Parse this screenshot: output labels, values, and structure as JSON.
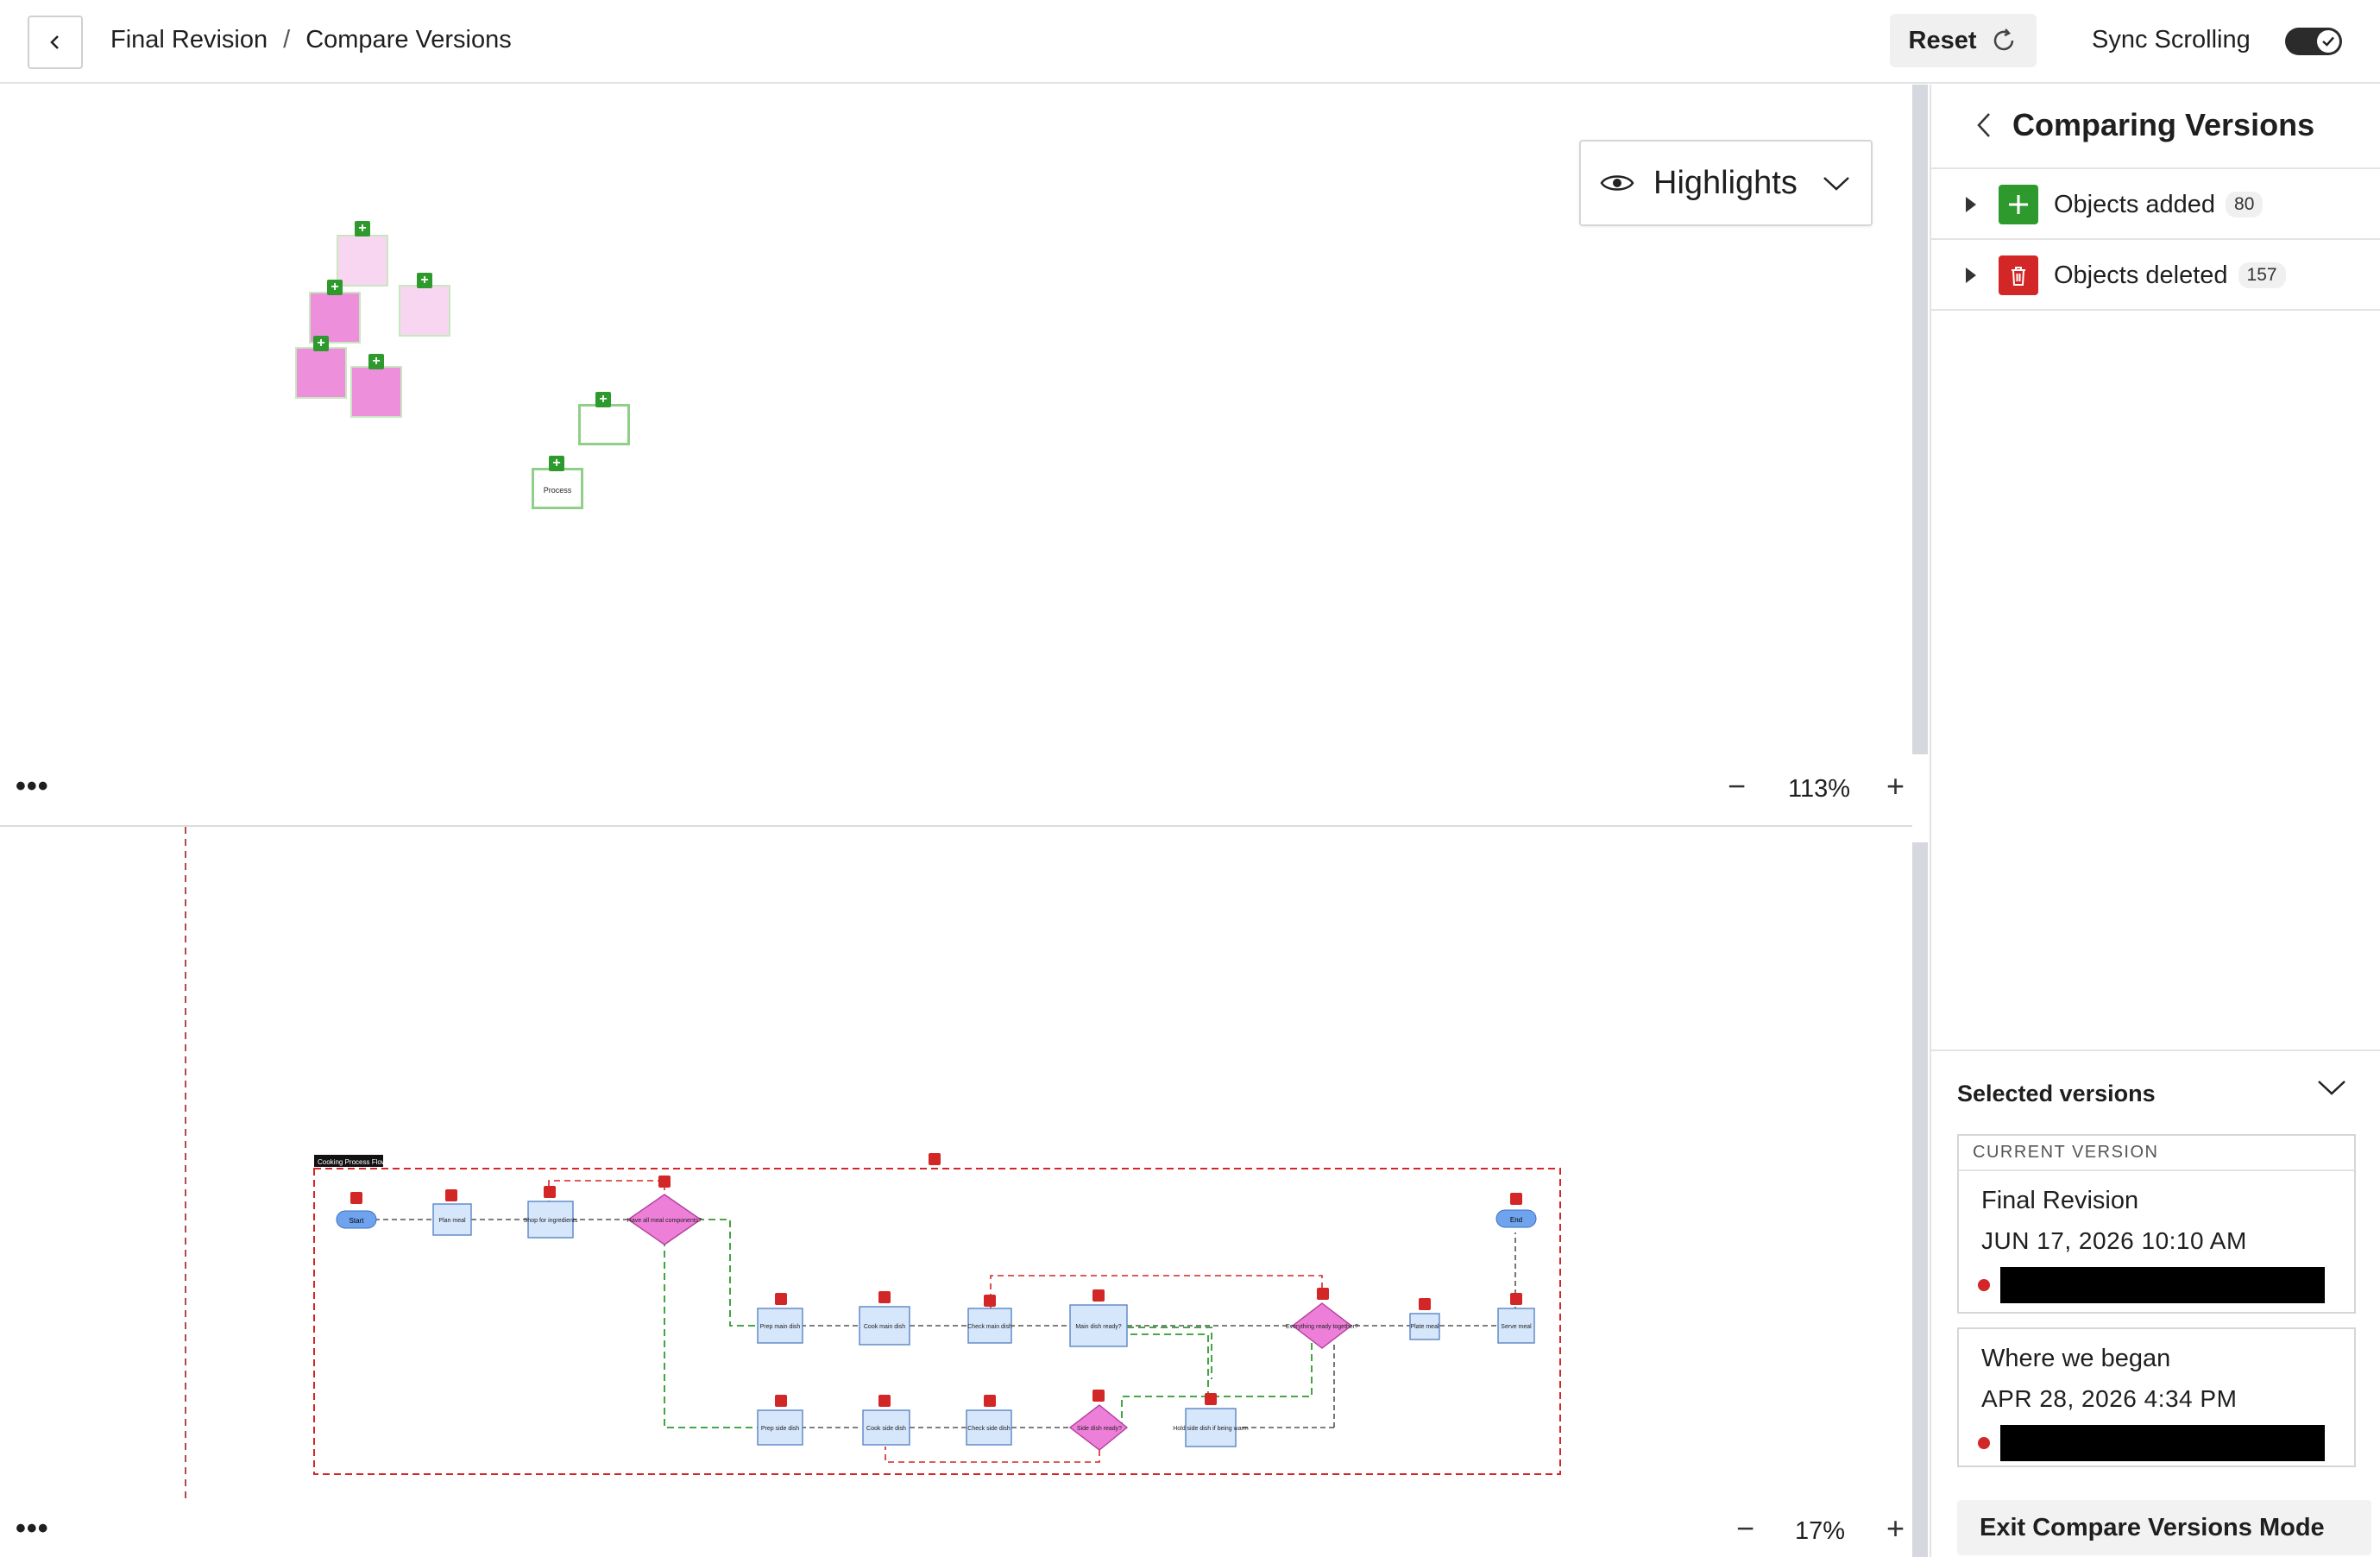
{
  "header": {
    "breadcrumb_root": "Final Revision",
    "breadcrumb_sep": "/",
    "breadcrumb_current": "Compare Versions",
    "reset_label": "Reset",
    "sync_label": "Sync Scrolling",
    "sync_enabled": true
  },
  "highlights": {
    "label": "Highlights"
  },
  "top_pane": {
    "zoom": "113%",
    "process_label": "Process"
  },
  "bottom_pane": {
    "zoom": "17%",
    "container_label": "Cooking Process Flowchart",
    "nodes": {
      "start": "Start",
      "plan": "Plan meal",
      "shop": "Shop for ingredients",
      "have_all": "Have all meal components?",
      "prep_main": "Prep main dish",
      "cook_main": "Cook main dish",
      "check_main": "Check main dish",
      "main_ready": "Main dish ready?",
      "prep_side": "Prep side dish",
      "cook_side": "Cook side dish",
      "check_side": "Check side dish",
      "side_ready": "Side dish ready?",
      "hold_side": "Hold side dish if being warm",
      "everything": "Everything ready together?",
      "plate": "Plate meal",
      "serve": "Serve meal",
      "end": "End"
    }
  },
  "panel": {
    "title": "Comparing Versions",
    "objects_added_label": "Objects added",
    "objects_added_count": "80",
    "objects_deleted_label": "Objects deleted",
    "objects_deleted_count": "157",
    "selected_versions": "Selected versions",
    "current_tag": "CURRENT VERSION",
    "current_name": "Final Revision",
    "current_date": "JUN 17, 2026  10:10 AM",
    "old_name": "Where we began",
    "old_date": "APR 28, 2026  4:34 PM",
    "exit_label": "Exit Compare Versions Mode"
  },
  "colors": {
    "added_green": "#2e9a2e",
    "deleted_red": "#d32626",
    "sticky_pink": "#ee8fdb",
    "sticky_light": "#f8d6f1",
    "node_blue": "#d6e6fb",
    "terminal_blue": "#6fa3ee",
    "decision_pink": "#ee7fd8"
  }
}
